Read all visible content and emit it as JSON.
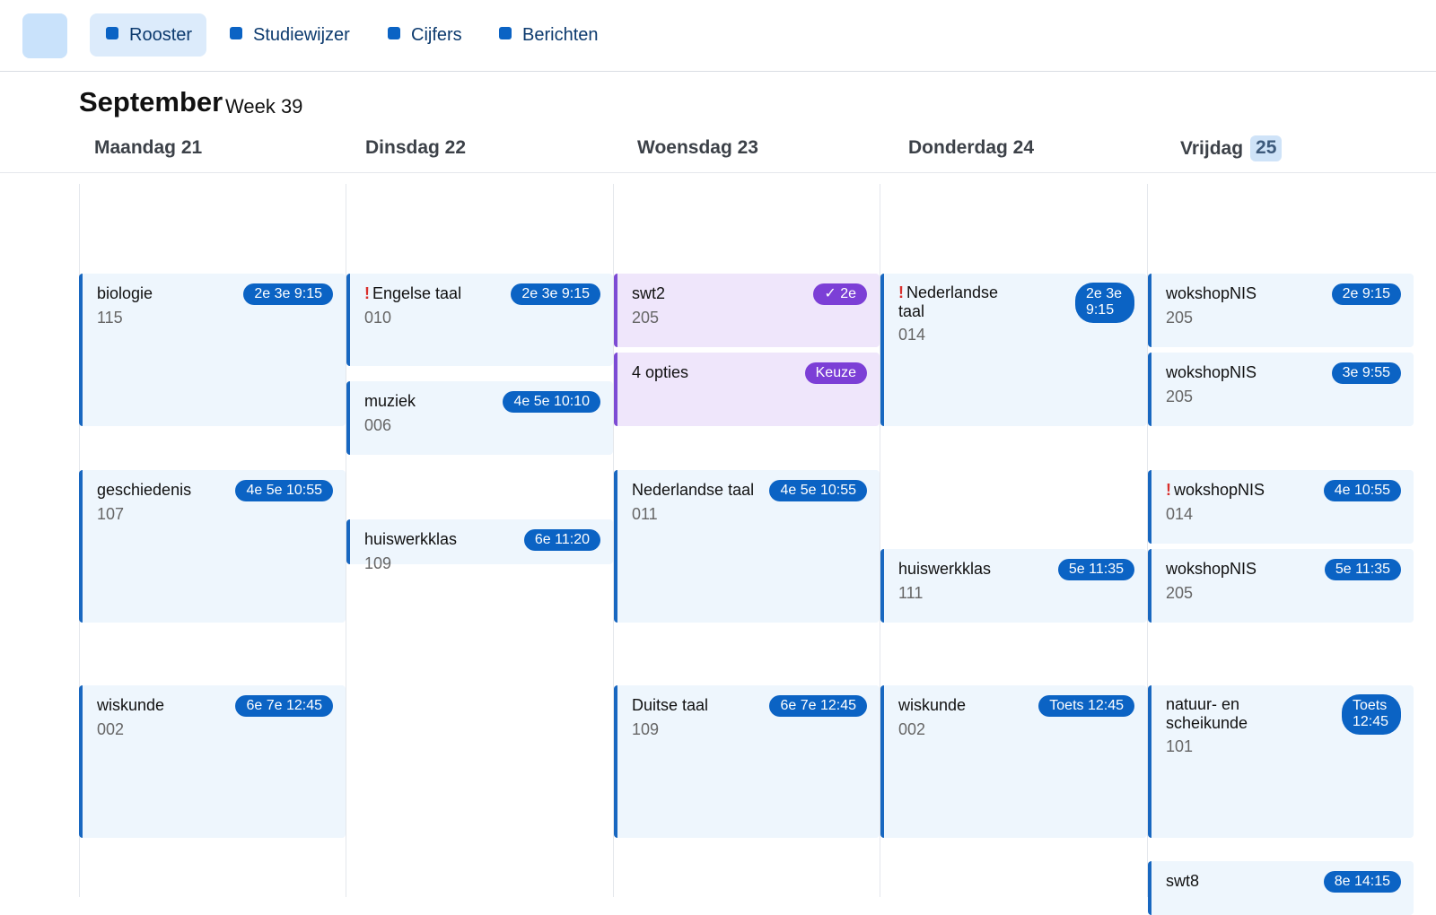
{
  "nav": {
    "items": [
      {
        "label": "Rooster",
        "active": true
      },
      {
        "label": "Studiewijzer",
        "active": false
      },
      {
        "label": "Cijfers",
        "active": false
      },
      {
        "label": "Berichten",
        "active": false
      }
    ]
  },
  "header": {
    "month": "September",
    "week": "Week 39"
  },
  "days": [
    {
      "name": "Maandag 21"
    },
    {
      "name": "Dinsdag 22"
    },
    {
      "name": "Woensdag 23"
    },
    {
      "name": "Donderdag 24"
    },
    {
      "name": "Vrijdag",
      "num": "25"
    }
  ],
  "lessons": {
    "mon": [
      {
        "subject": "biologie",
        "room": "115",
        "badge": "2e 3e 9:15"
      },
      {
        "subject": "geschiedenis",
        "room": "107",
        "badge": "4e 5e 10:55"
      },
      {
        "subject": "wiskunde",
        "room": "002",
        "badge": "6e 7e 12:45"
      }
    ],
    "tue": [
      {
        "subject": "Engelse taal",
        "room": "010",
        "badge": "2e 3e 9:15",
        "alert": "!"
      },
      {
        "subject": "muziek",
        "room": "006",
        "badge": "4e 5e 10:10"
      },
      {
        "subject": "huiswerkklas",
        "room": "109",
        "badge": "6e 11:20"
      }
    ],
    "wed": [
      {
        "subject": "swt2",
        "room": "205",
        "badge": "✓ 2e"
      },
      {
        "subject": "4 opties",
        "badge": "Keuze"
      },
      {
        "subject": "Nederlandse taal",
        "room": "011",
        "badge": "4e 5e 10:55"
      },
      {
        "subject": "Duitse taal",
        "room": "109",
        "badge": "6e 7e 12:45"
      }
    ],
    "thu": [
      {
        "subject_1": "Nederlandse",
        "subject_2": "taal",
        "room": "014",
        "badge_1": "2e 3e",
        "badge_2": "9:15",
        "alert": "!"
      },
      {
        "subject": "huiswerkklas",
        "room": "111",
        "badge": "5e 11:35"
      },
      {
        "subject": "wiskunde",
        "room": "002",
        "badge": "Toets 12:45"
      }
    ],
    "fri": [
      {
        "subject": "wokshopNIS",
        "room": "205",
        "badge": "2e 9:15"
      },
      {
        "subject": "wokshopNIS",
        "room": "205",
        "badge": "3e 9:55"
      },
      {
        "subject": "wokshopNIS",
        "room": "014",
        "badge": "4e 10:55",
        "alert": "!"
      },
      {
        "subject": "wokshopNIS",
        "room": "205",
        "badge": "5e 11:35"
      },
      {
        "subject_1": "natuur- en",
        "subject_2": "scheikunde",
        "room": "101",
        "badge_1": "Toets",
        "badge_2": "12:45"
      },
      {
        "subject": "swt8",
        "badge": "8e 14:15"
      }
    ]
  },
  "colors": {
    "accent": "#0b63c4",
    "card_bg": "#eef6fd",
    "choice_bg": "#efe6fb",
    "choice_badge": "#7c3fd6",
    "alert": "#d9302c"
  }
}
